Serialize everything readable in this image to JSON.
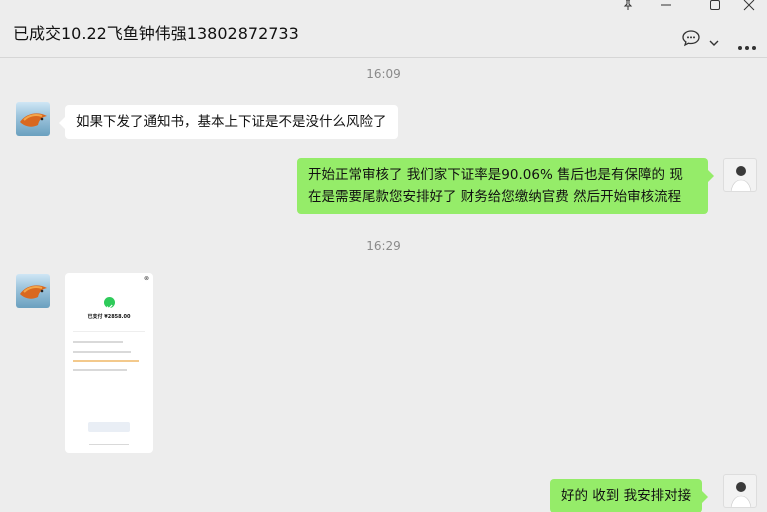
{
  "header": {
    "title": "已成交10.22飞鱼钟伟强13802872733"
  },
  "window_controls": {
    "icons": [
      "pin-icon",
      "minimize-icon",
      "maximize-icon",
      "close-icon"
    ]
  },
  "chat_actions": {
    "icons": [
      "chat-bubble-icon",
      "chevron-down-icon",
      "more-icon"
    ]
  },
  "timestamps": [
    "16:09",
    "16:29"
  ],
  "messages": [
    {
      "side": "left",
      "text": "如果下发了通知书，基本上下证是不是没什么风险了"
    },
    {
      "side": "right",
      "line1": "开始正常审核了 我们家下证率是90.06% 售后也是有保障的  现",
      "line2": "在是需要尾款您安排好了 财务给您缴纳官费 然后开始审核流程"
    },
    {
      "side": "left",
      "type": "image",
      "amount": "已支付 ¥2858.00"
    },
    {
      "side": "right",
      "text": "好的 收到 我安排对接"
    }
  ],
  "colors": {
    "background": "#ededed",
    "bubble_left": "#ffffff",
    "bubble_right": "#95ec69",
    "success": "#2ecb5a"
  }
}
